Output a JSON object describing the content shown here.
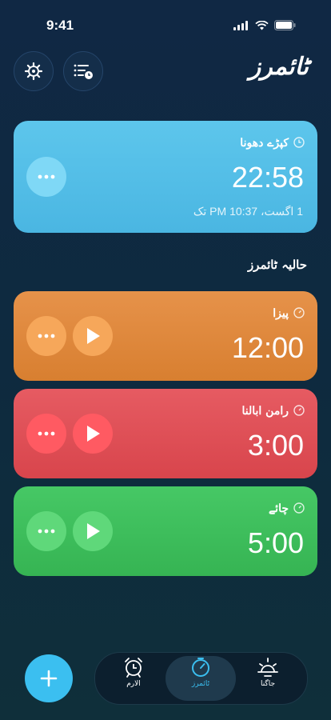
{
  "status": {
    "time": "9:41"
  },
  "header": {
    "title": "ٹائمرز"
  },
  "active_timer": {
    "name": "کپڑے دھونا",
    "duration": "22:58",
    "until": "1 اگست، 10:37 PM تک",
    "color": "#58c3ea"
  },
  "recent_section": {
    "title": "حالیہ ٹائمرز"
  },
  "recent_timers": [
    {
      "name": "پیزا",
      "duration": "12:00",
      "color": "#e28a3a"
    },
    {
      "name": "رامن ابالنا",
      "duration": "3:00",
      "color": "#e2535a"
    },
    {
      "name": "چائے",
      "duration": "5:00",
      "color": "#3fc05e"
    }
  ],
  "tabs": [
    {
      "label": "الارم",
      "icon": "alarm-clock-icon"
    },
    {
      "label": "ٹائمرز",
      "icon": "timer-icon"
    },
    {
      "label": "جاگنا",
      "icon": "sunrise-icon"
    }
  ],
  "colors": {
    "accent": "#3bbff0"
  }
}
